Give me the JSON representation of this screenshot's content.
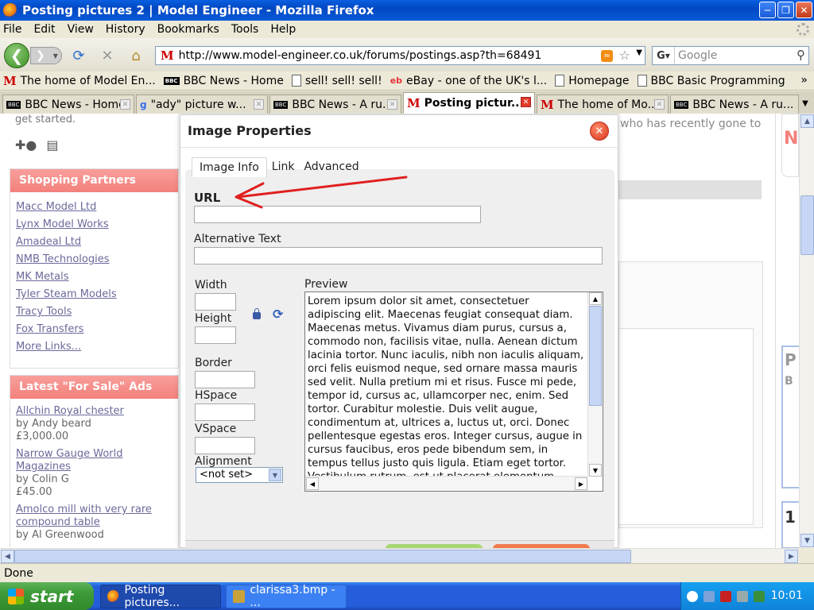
{
  "window": {
    "title": "Posting pictures 2 | Model Engineer - Mozilla Firefox"
  },
  "menu": [
    "File",
    "Edit",
    "View",
    "History",
    "Bookmarks",
    "Tools",
    "Help"
  ],
  "nav": {
    "url": "http://www.model-engineer.co.uk/forums/postings.asp?th=68491",
    "search_placeholder": "Google"
  },
  "bookmarks": [
    {
      "label": "The home of Model En...",
      "icon": "m-icon"
    },
    {
      "label": "BBC News - Home",
      "icon": "bbc-icon"
    },
    {
      "label": "sell! sell! sell!",
      "icon": "page-icon"
    },
    {
      "label": "eBay - one of the UK's l...",
      "icon": "ebay-icon"
    },
    {
      "label": "Homepage",
      "icon": "page-icon"
    },
    {
      "label": "BBC Basic Programming",
      "icon": "page-icon"
    }
  ],
  "tabs": [
    {
      "label": "BBC News - Home",
      "icon": "bbc-icon",
      "active": false
    },
    {
      "label": "\"ady\" picture w...",
      "icon": "google-icon",
      "active": false
    },
    {
      "label": "BBC News - A ru...",
      "icon": "bbc-icon",
      "active": false
    },
    {
      "label": "Posting pictur...",
      "icon": "m-icon",
      "active": true
    },
    {
      "label": "The home of Mo...",
      "icon": "m-icon",
      "active": false
    },
    {
      "label": "BBC News - A ru...",
      "icon": "bbc-icon",
      "active": false
    }
  ],
  "page": {
    "intro_text": "get started.",
    "bg_text_1": "who has recently gone to",
    "bg_letter_1": "N",
    "bg_letter_2": "P",
    "bg_letter_3": "B",
    "bg_letter_4": "1",
    "shopping": {
      "title": "Shopping Partners",
      "links": [
        "Macc Model Ltd",
        "Lynx Model Works",
        "Amadeal Ltd",
        "NMB Technologies",
        "MK Metals",
        "Tyler Steam Models",
        "Tracy Tools",
        "Fox Transfers",
        "More Links..."
      ]
    },
    "ads": {
      "title": "Latest \"For Sale\" Ads",
      "items": [
        {
          "title": "Allchin Royal chester",
          "by": "by Andy beard",
          "price": "£3,000.00"
        },
        {
          "title": "Narrow Gauge World Magazines",
          "by": "by Colin G",
          "price": "£45.00"
        },
        {
          "title": "Amolco mill with very rare compound table",
          "by": "by Al Greenwood",
          "price": ""
        }
      ]
    }
  },
  "dialog": {
    "title": "Image Properties",
    "tabs": [
      "Image Info",
      "Link",
      "Advanced"
    ],
    "url_label": "URL",
    "url_value": "",
    "alt_label": "Alternative Text",
    "alt_value": "",
    "width_label": "Width",
    "height_label": "Height",
    "border_label": "Border",
    "hspace_label": "HSpace",
    "vspace_label": "VSpace",
    "alignment_label": "Alignment",
    "alignment_value": "<not set>",
    "preview_label": "Preview",
    "preview_text": "Lorem ipsum dolor sit amet, consectetuer adipiscing elit. Maecenas feugiat consequat diam. Maecenas metus. Vivamus diam purus, cursus a, commodo non, facilisis vitae, nulla. Aenean dictum lacinia tortor. Nunc iaculis, nibh non iaculis aliquam, orci felis euismod neque, sed ornare massa mauris sed velit. Nulla pretium mi et risus. Fusce mi pede, tempor id, cursus ac, ullamcorper nec, enim. Sed tortor. Curabitur molestie. Duis velit augue, condimentum at, ultrices a, luctus ut, orci. Donec pellentesque egestas eros. Integer cursus, augue in cursus faucibus, eros pede bibendum sem, in tempus tellus justo quis ligula. Etiam eget tortor. Vestibulum rutrum, est ut placerat elementum, lectus nisl aliquam velit, tempor aliquam eros nunc nonummy metus.",
    "annotation_color": "#e02020"
  },
  "status": "Done",
  "taskbar": {
    "start": "start",
    "tasks": [
      {
        "label": "Posting pictures...",
        "active": true
      },
      {
        "label": "clarissa3.bmp - ...",
        "active": false
      }
    ],
    "clock": "10:01"
  }
}
